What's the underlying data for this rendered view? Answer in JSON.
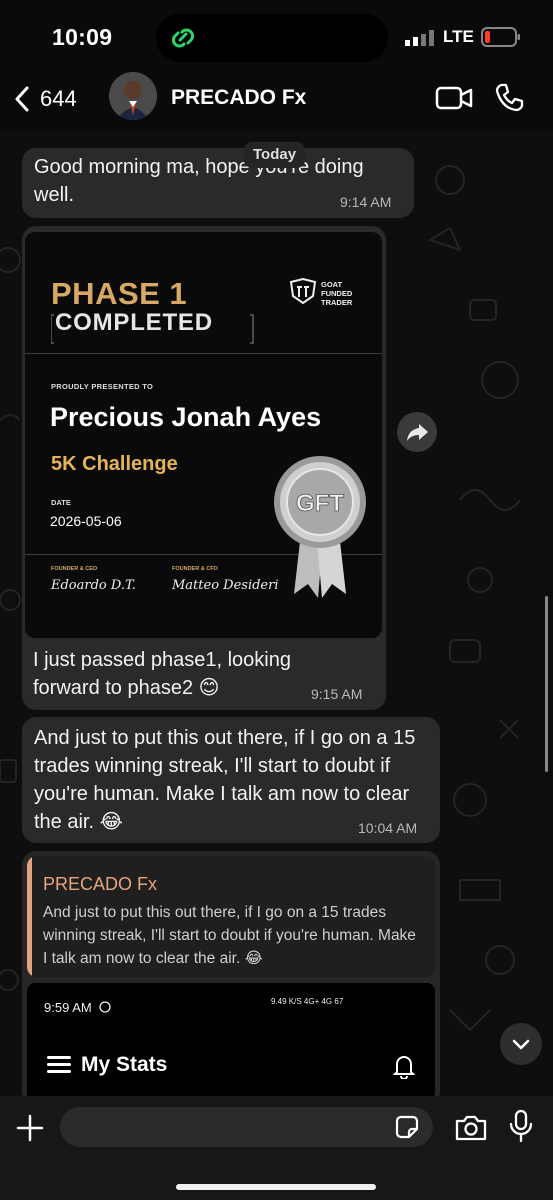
{
  "status_bar": {
    "time": "10:09",
    "network": "LTE"
  },
  "header": {
    "back_count": "644",
    "contact_name": "PRECADO Fx"
  },
  "date_pill": "Today",
  "messages": [
    {
      "text": "Good morning ma, hope you're doing well.",
      "time": "9:14 AM"
    },
    {
      "text": "I just passed phase1, looking forward to phase2 😊",
      "time": "9:15 AM"
    },
    {
      "text": "And just to put this out there, if I go on a 15 trades winning streak, I'll start to doubt if you're human. Make I talk am now to clear the air. 😂",
      "time": "10:04 AM"
    }
  ],
  "certificate": {
    "title_line1": "PHASE 1",
    "title_line2": "COMPLETED",
    "logo_text": [
      "GOAT",
      "FUNDED",
      "TRADER"
    ],
    "presented_label": "PROUDLY PRESENTED TO",
    "recipient": "Precious Jonah Ayes",
    "challenge": "5K Challenge",
    "date_label": "DATE",
    "date": "2026-05-06",
    "founder1_role": "FOUNDER & CEO",
    "founder1_sign": "Edoardo D.T.",
    "founder2_role": "FOUNDER & CFO",
    "founder2_sign": "Matteo Desideri",
    "medal_text": "GFT"
  },
  "reply": {
    "quoted_name": "PRECADO Fx",
    "quoted_text": "And just to put this out there, if I go on a 15 trades winning streak, I'll start to doubt if you're human. Make I talk am now to clear the air. 😂",
    "screenshot": {
      "time": "9:59 AM",
      "status": "9.49 K/S  4G+ 4G  67",
      "title": "My Stats"
    }
  },
  "input": {
    "placeholder": ""
  },
  "colors": {
    "quote_accent": "#e2a57f",
    "cert_gold": "#d7a964",
    "challenge_gold": "#e6b458",
    "bubble": "#2a2a2a"
  },
  "icons": [
    "back-chevron-icon",
    "video-call-icon",
    "phone-call-icon",
    "forward-icon",
    "chevron-down-icon",
    "plus-icon",
    "sticker-icon",
    "camera-icon",
    "microphone-icon"
  ]
}
